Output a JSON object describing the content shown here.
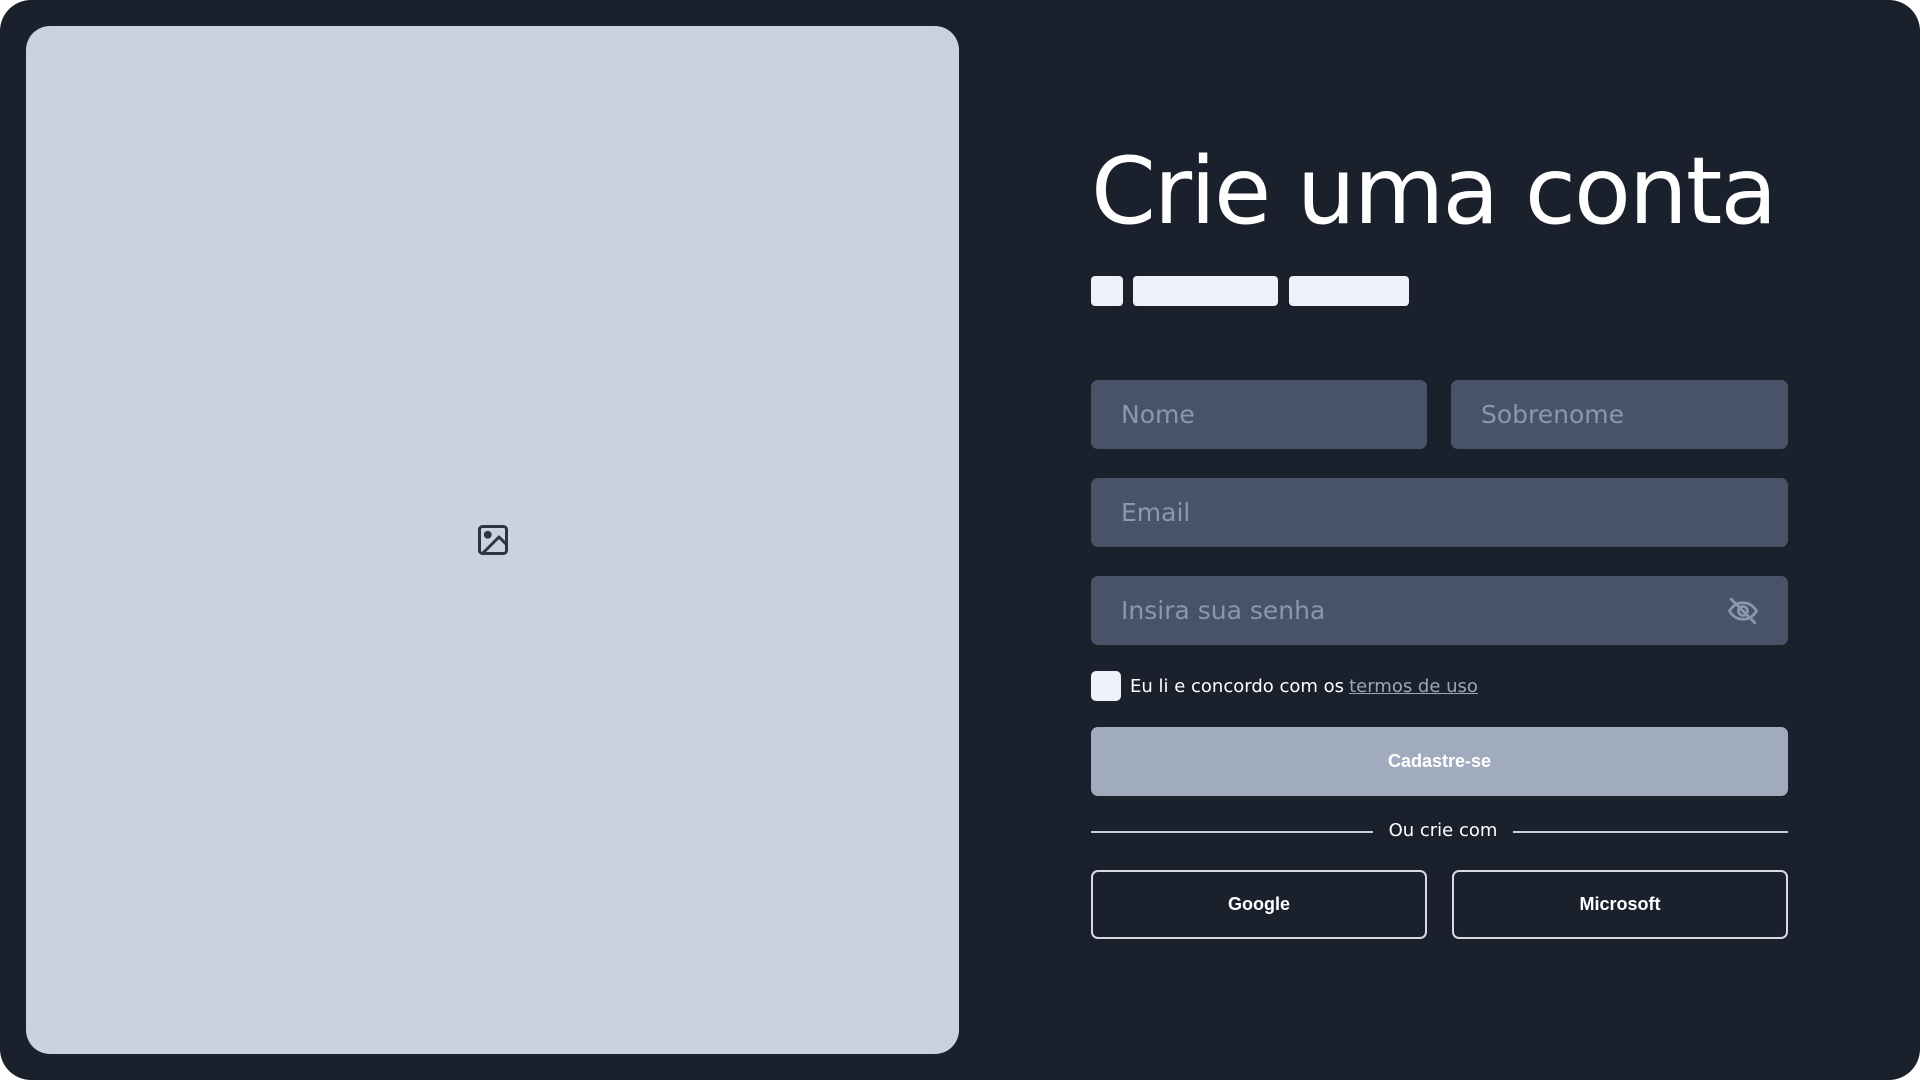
{
  "colors": {
    "background": "#1b202d",
    "image_panel": "#cbd2df",
    "input_bg": "#485367",
    "placeholder_text": "#8c97ab",
    "submit_bg": "#a1abbe",
    "link": "#9ba6ba"
  },
  "media": {
    "icon": "image-icon"
  },
  "form": {
    "title": "Crie uma conta",
    "first_name": {
      "value": "",
      "placeholder": "Nome"
    },
    "last_name": {
      "value": "",
      "placeholder": "Sobrenome"
    },
    "email": {
      "value": "",
      "placeholder": "Email"
    },
    "password": {
      "value": "",
      "placeholder": "Insira sua senha",
      "toggle_icon": "eye-off-icon"
    },
    "terms": {
      "checked": false,
      "text": "Eu li e concordo com os",
      "link_text": "termos de uso"
    },
    "submit_label": "Cadastre-se",
    "divider_text": "Ou crie com",
    "social": {
      "google_label": "Google",
      "microsoft_label": "Microsoft"
    }
  }
}
